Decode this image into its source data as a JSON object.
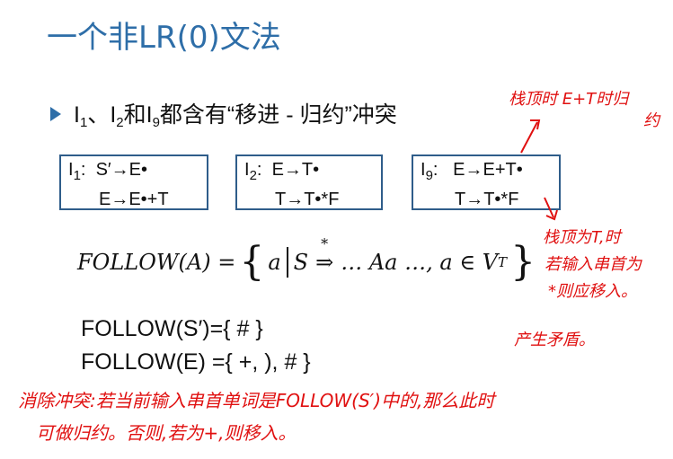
{
  "slide": {
    "title": "一个非LR(0)文法",
    "bullet": {
      "i1": "I",
      "s1": "1",
      "sep1": "、",
      "i2": "I",
      "s2": "2",
      "mid": "和",
      "i9": "I",
      "s9": "9",
      "rest": "都含有“移进 - 归约”冲突"
    },
    "boxes": [
      {
        "label_i": "I",
        "label_sub": "1",
        "label_colon": ":",
        "line1": "S′→E•",
        "line2": "E→E•+T"
      },
      {
        "label_i": "I",
        "label_sub": "2",
        "label_colon": ":",
        "line1": "E→T•",
        "line2": "T→T•*F"
      },
      {
        "label_i": "I",
        "label_sub": "9",
        "label_colon": ":",
        "line1": "E→E+T•",
        "line2": "T→T•*F"
      }
    ],
    "formula": {
      "lhs": "FOLLOW(A) =",
      "lbrace": "{",
      "a": "a",
      "s": "S",
      "arrow": "⇒",
      "star": "*",
      "body": "… Aa …, a ∈ V",
      "body_sub": "T",
      "rbrace": "}"
    },
    "follow_s": "FOLLOW(S′)={ # }",
    "follow_e": "FOLLOW(E) ={ +, ), # }"
  },
  "annotations": {
    "top_right_line1": "栈顶时 E+T时归",
    "top_right_line2": "约",
    "right_1": "栈顶为T,时",
    "right_2": "若输入串首为",
    "right_3": "*则应移入。",
    "right_4": "产生矛盾。",
    "bottom_1": "消除冲突:若当前输入串首单词是FOLLOW(S′)中的,那么此时",
    "bottom_2": "可做归约。否则,若为+,则移入。"
  },
  "colors": {
    "title": "#2e6ea8",
    "box_border": "#2f5d8a",
    "annotation": "#e01010"
  }
}
